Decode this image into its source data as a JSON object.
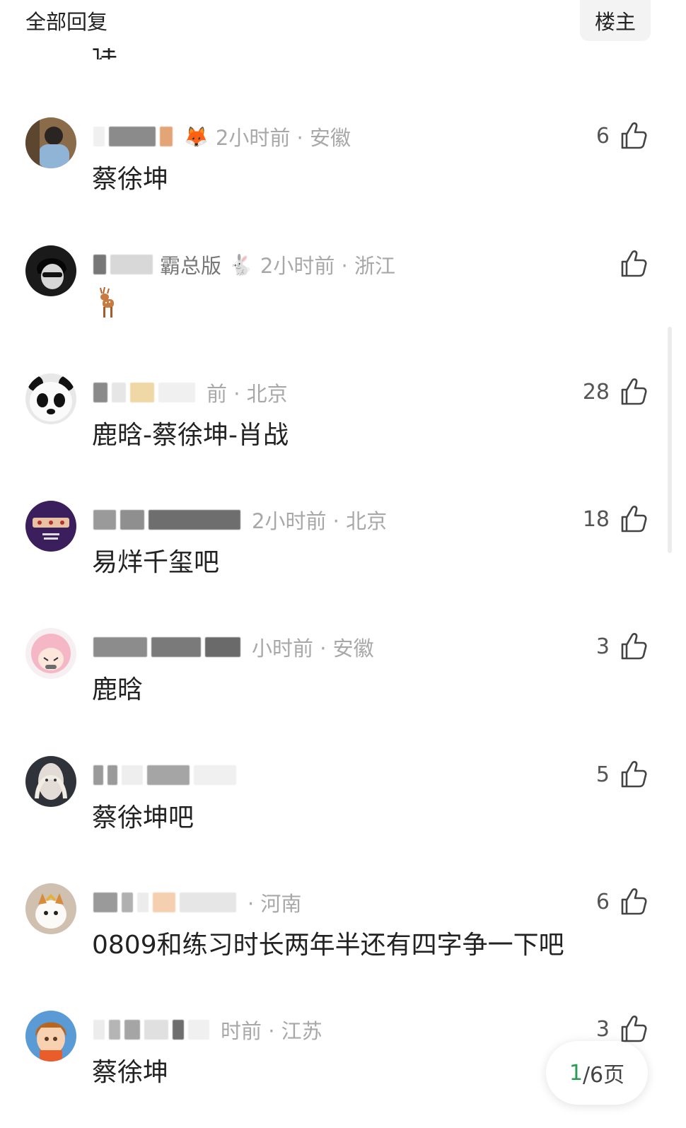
{
  "header": {
    "title": "全部回复",
    "owner_button": "楼主"
  },
  "cutoff_text": "详",
  "comments": [
    {
      "time_location": "2小时前 · 安徽",
      "badge": "🦊",
      "text": "蔡徐坤",
      "likes": "6"
    },
    {
      "name_suffix": "霸总版",
      "badge": "🐇",
      "time_location": "2小时前 · 浙江",
      "text": "",
      "likes": ""
    },
    {
      "time_location": "前 · 北京",
      "text": "鹿晗-蔡徐坤-肖战",
      "likes": "28"
    },
    {
      "time_location": "2小时前 · 北京",
      "text": "易烊千玺吧",
      "likes": "18"
    },
    {
      "time_location": "小时前 · 安徽",
      "text": "鹿晗",
      "likes": "3"
    },
    {
      "time_location": "",
      "text": "蔡徐坤吧",
      "likes": "5"
    },
    {
      "time_location": "· 河南",
      "text": "0809和练习时长两年半还有四字争一下吧",
      "likes": "6"
    },
    {
      "time_location": "时前 · 江苏",
      "text": "蔡徐坤",
      "likes": "3"
    }
  ],
  "pager": {
    "current": "1",
    "rest": "/6页"
  },
  "icons": {
    "like": "thumbs-up-icon",
    "deer": "deer-icon"
  }
}
